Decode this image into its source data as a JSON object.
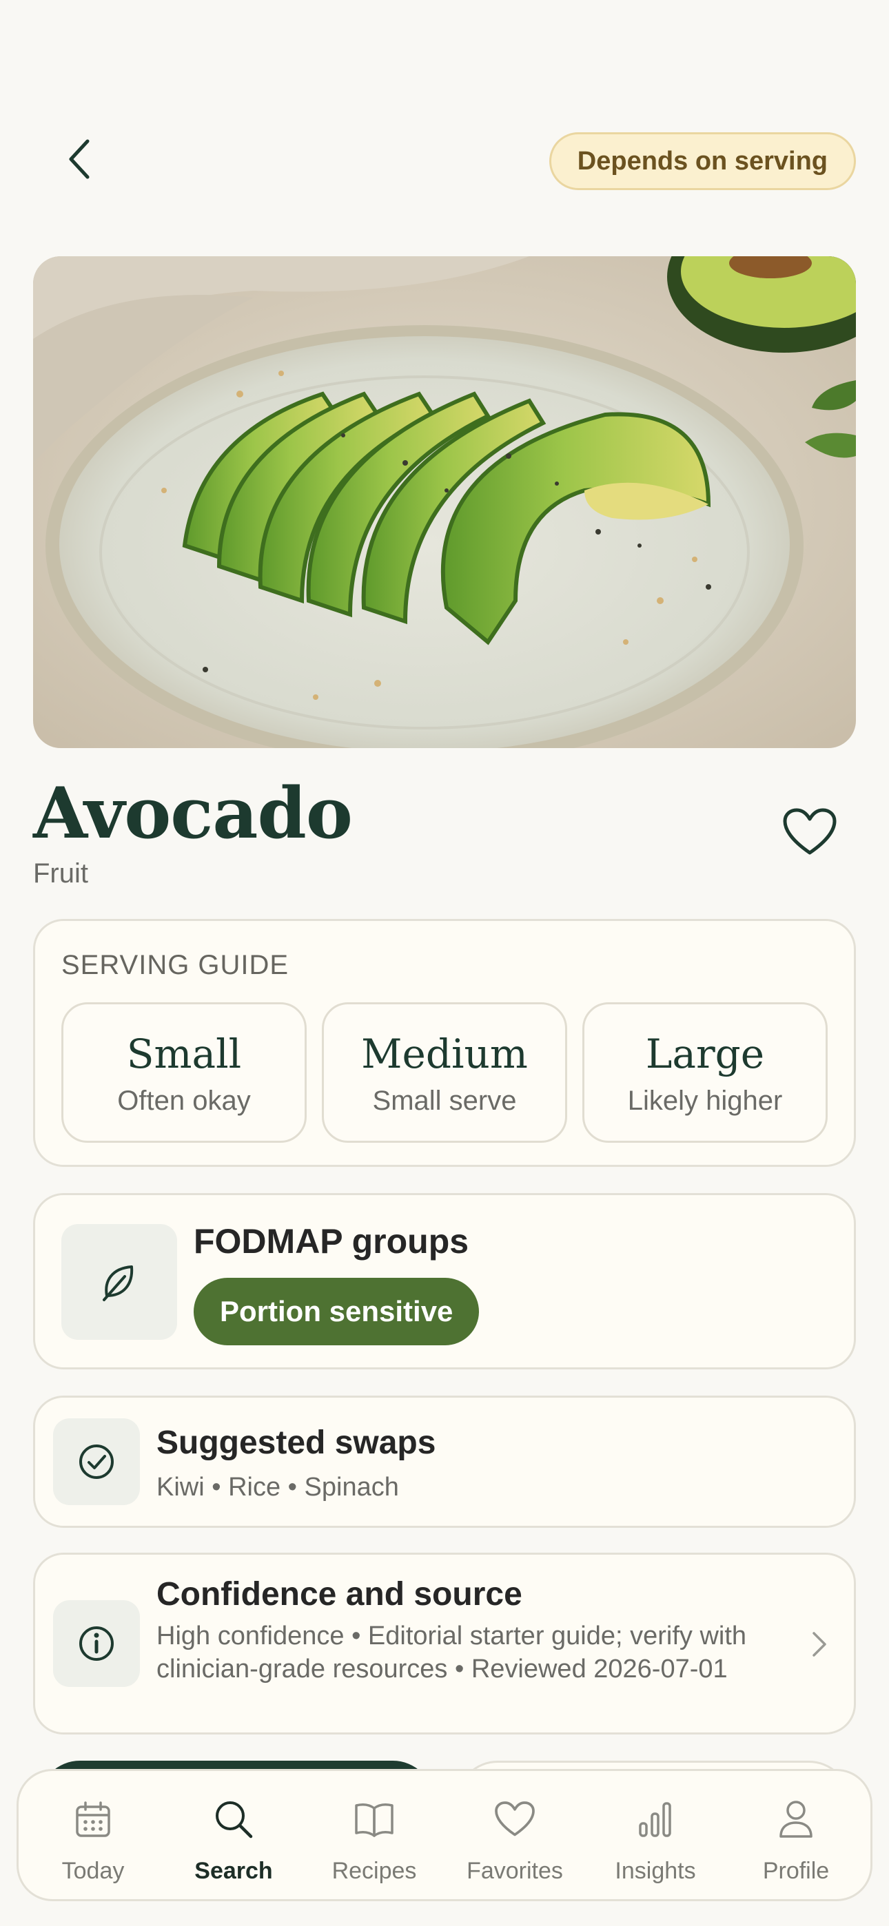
{
  "header": {
    "back_icon": "chevron-left-icon",
    "status_badge": "Depends on serving"
  },
  "food": {
    "name": "Avocado",
    "category": "Fruit",
    "favorite_icon": "heart-icon"
  },
  "serving_guide": {
    "label": "SERVING GUIDE",
    "options": [
      {
        "name": "Small",
        "desc": "Often okay"
      },
      {
        "name": "Medium",
        "desc": "Small serve"
      },
      {
        "name": "Large",
        "desc": "Likely higher"
      }
    ]
  },
  "fodmap": {
    "title": "FODMAP groups",
    "icon": "leaf-icon",
    "pill": "Portion sensitive"
  },
  "swaps": {
    "title": "Suggested swaps",
    "icon": "check-circle-icon",
    "items": "Kiwi • Rice • Spinach"
  },
  "source": {
    "title": "Confidence and source",
    "icon": "info-icon",
    "detail": "High confidence • Editorial starter guide; verify with clinician-grade resources • Reviewed 2026-07-01"
  },
  "nav": {
    "items": [
      {
        "label": "Today",
        "icon": "calendar-icon"
      },
      {
        "label": "Search",
        "icon": "search-icon"
      },
      {
        "label": "Recipes",
        "icon": "book-icon"
      },
      {
        "label": "Favorites",
        "icon": "heart-icon"
      },
      {
        "label": "Insights",
        "icon": "bar-chart-icon"
      },
      {
        "label": "Profile",
        "icon": "user-icon"
      }
    ],
    "active": "Search"
  },
  "colors": {
    "background": "#f9f8f4",
    "primary_dark": "#1d3a2f",
    "pill_green": "#4e7232",
    "badge_bg": "#fbf0cf",
    "badge_text": "#6b5220"
  }
}
